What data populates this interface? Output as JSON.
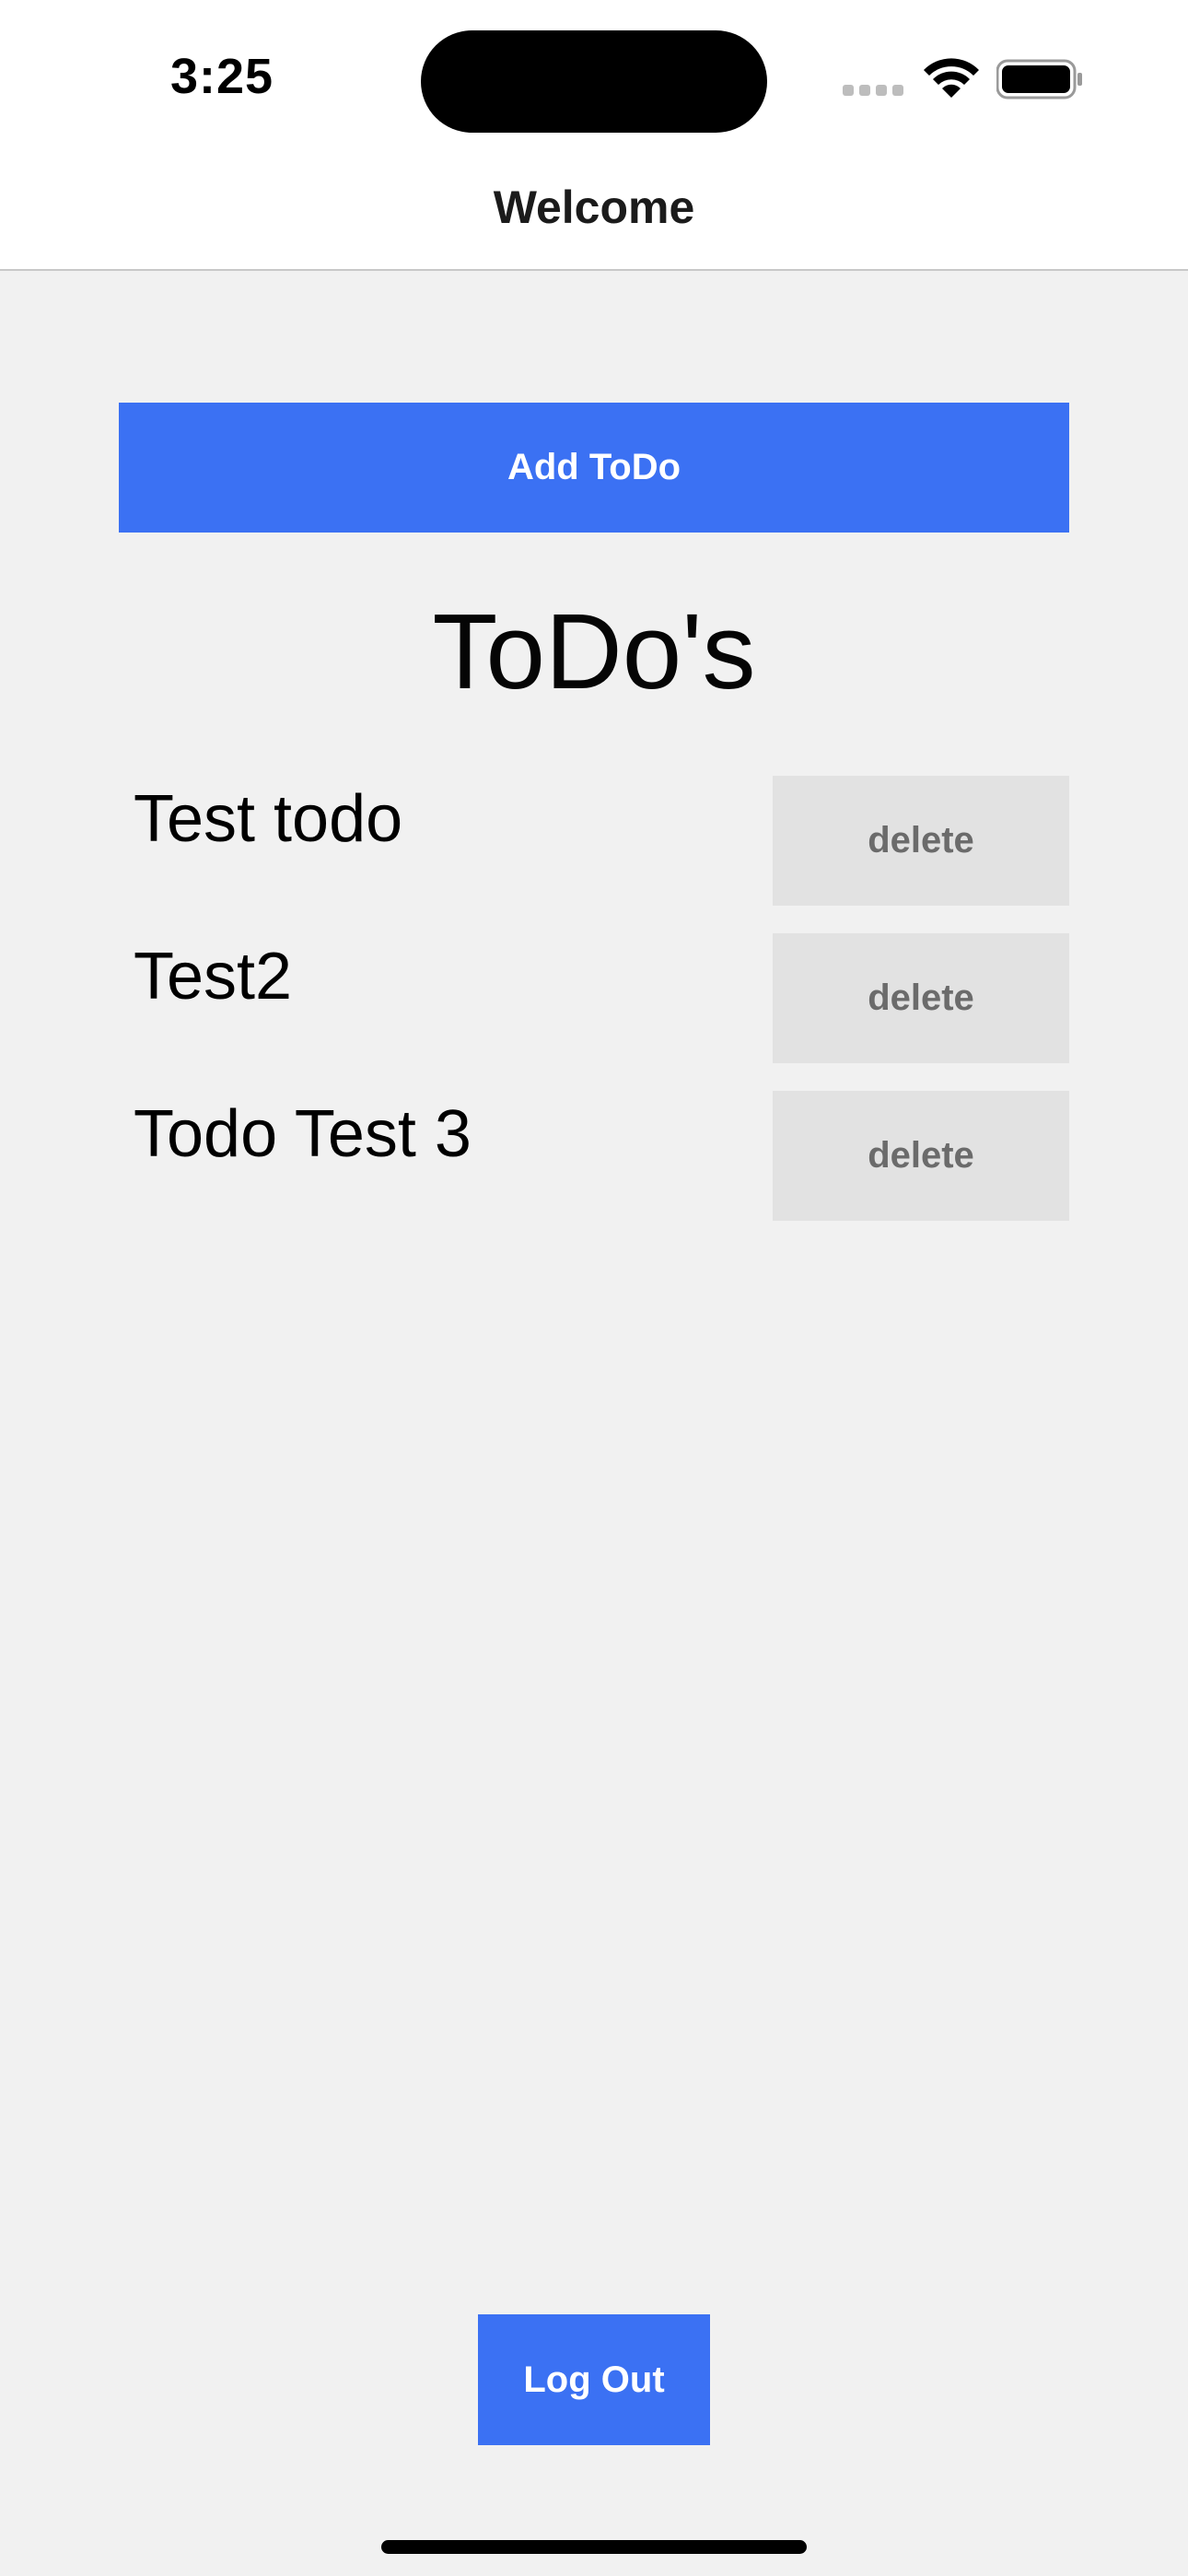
{
  "status_bar": {
    "time": "3:25",
    "icons": [
      "signal-icon",
      "wifi-icon",
      "battery-icon"
    ]
  },
  "nav": {
    "title": "Welcome"
  },
  "actions": {
    "add_label": "Add ToDo",
    "logout_label": "Log Out"
  },
  "list": {
    "title": "ToDo's",
    "items": [
      {
        "text": "Test todo",
        "delete_label": "delete"
      },
      {
        "text": "Test2",
        "delete_label": "delete"
      },
      {
        "text": "Todo Test 3",
        "delete_label": "delete"
      }
    ]
  },
  "colors": {
    "primary_button": "#3b71f3",
    "secondary_button": "#e2e2e2",
    "background": "#f1f1f1"
  }
}
